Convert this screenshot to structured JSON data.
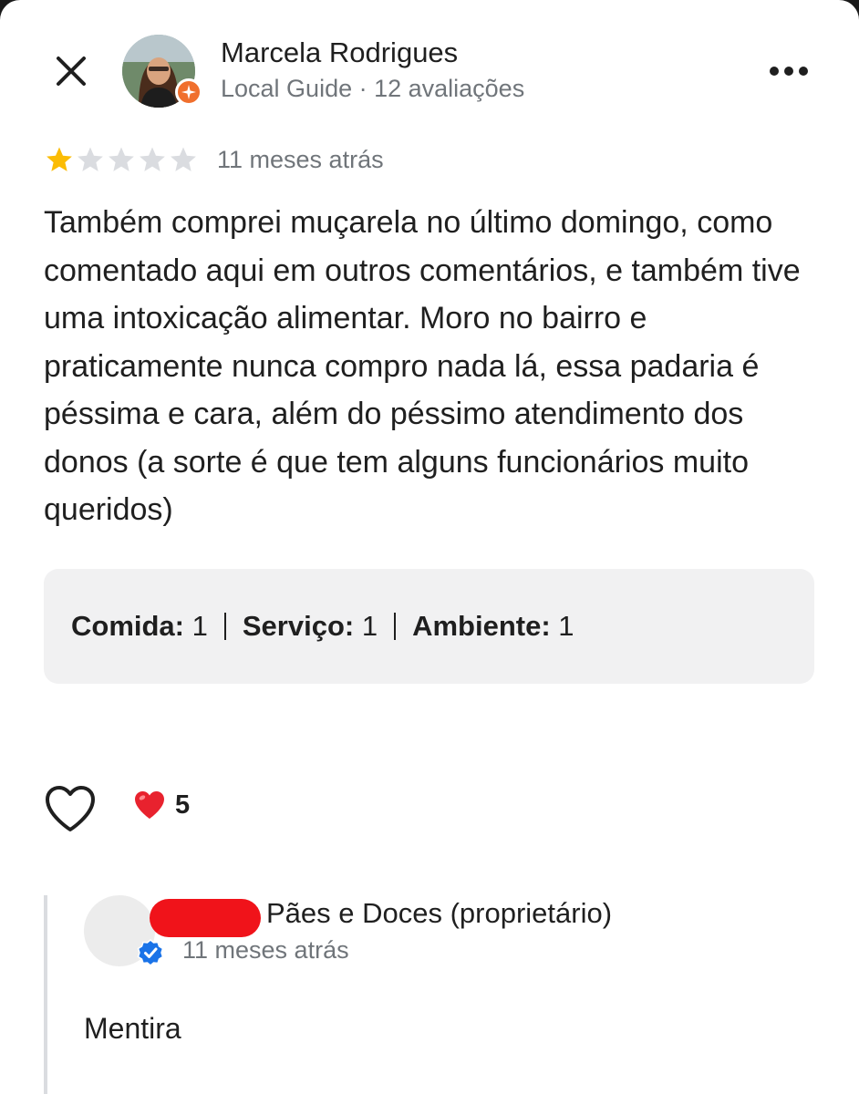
{
  "header": {
    "close_icon": "close-icon",
    "more_icon": "more-horizontal-icon"
  },
  "reviewer": {
    "name": "Marcela Rodrigues",
    "meta": "Local Guide · 12 avaliações",
    "badge_icon": "local-guide-star-icon",
    "badge_color": "#f06f2d"
  },
  "review": {
    "rating": 1,
    "max_rating": 5,
    "star_color": "#fbbc04",
    "star_empty_color": "#dadce0",
    "time": "11 meses atrás",
    "text": "Também comprei muçarela no último domingo, como comentado aqui em outros comentários, e também tive uma intoxicação alimentar. Moro no bairro e praticamente nunca compro nada lá, essa padaria é péssima e cara, além do péssimo atendimento dos donos (a sorte é que tem alguns funcionários muito queridos)"
  },
  "sub_ratings": [
    {
      "label": "Comida:",
      "value": "1"
    },
    {
      "label": "Serviço:",
      "value": "1"
    },
    {
      "label": "Ambiente:",
      "value": "1"
    }
  ],
  "reactions": {
    "like_icon": "heart-outline-icon",
    "reaction_icon": "red-heart-icon",
    "count": "5"
  },
  "owner_reply": {
    "name": "Pães e Doces (proprietário)",
    "time": "11 meses atrás",
    "text": "Mentira",
    "verified_icon": "verified-check-icon",
    "redaction_color": "#f0131a"
  }
}
